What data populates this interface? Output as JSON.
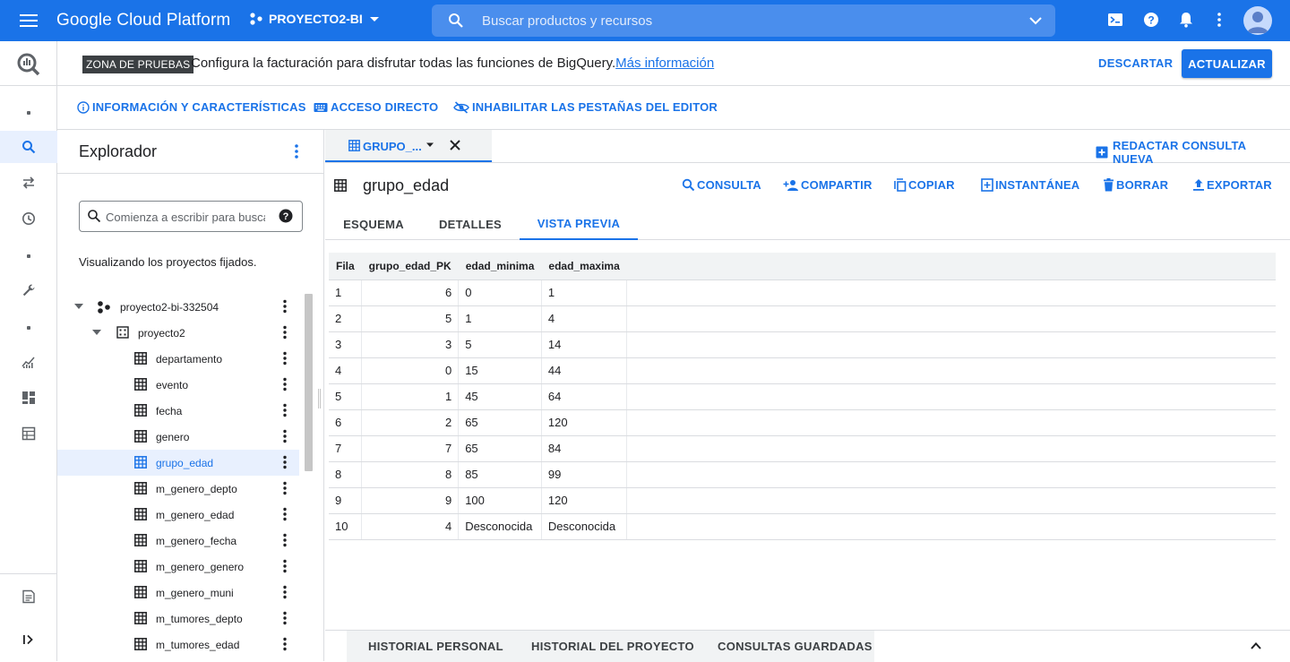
{
  "topbar": {
    "brand": "Google Cloud Platform",
    "project": "PROYECTO2-BI",
    "search_placeholder": "Buscar productos y recursos"
  },
  "banner": {
    "badge": "ZONA DE PRUEBAS",
    "message": "Configura la facturación para disfrutar todas las funciones de BigQuery.",
    "link": "Más información",
    "discard": "DESCARTAR",
    "update": "ACTUALIZAR"
  },
  "info_links": {
    "info": "INFORMACIÓN Y CARACTERÍSTICAS",
    "shortcut": "ACCESO DIRECTO",
    "disable_tabs": "INHABILITAR LAS PESTAÑAS DEL EDITOR"
  },
  "explorer": {
    "title": "Explorador",
    "search_placeholder": "Comienza a escribir para buscar",
    "pinned_note": "Visualizando los proyectos fijados.",
    "project": "proyecto2-bi-332504",
    "dataset": "proyecto2",
    "tables": [
      "departamento",
      "evento",
      "fecha",
      "genero",
      "grupo_edad",
      "m_genero_depto",
      "m_genero_edad",
      "m_genero_fecha",
      "m_genero_genero",
      "m_genero_muni",
      "m_tumores_depto",
      "m_tumores_edad"
    ],
    "selected_table": "grupo_edad"
  },
  "editor": {
    "tab_label": "GRUPO_...",
    "compose": "REDACTAR CONSULTA NUEVA",
    "table_name": "grupo_edad",
    "actions": {
      "query": "CONSULTA",
      "share": "COMPARTIR",
      "copy": "COPIAR",
      "snapshot": "INSTANTÁNEA",
      "delete": "BORRAR",
      "export": "EXPORTAR"
    },
    "subtabs": {
      "schema": "ESQUEMA",
      "details": "DETALLES",
      "preview": "VISTA PREVIA"
    }
  },
  "preview": {
    "columns": [
      "Fila",
      "grupo_edad_PK",
      "edad_minima",
      "edad_maxima"
    ],
    "rows": [
      [
        "1",
        "6",
        "0",
        "1"
      ],
      [
        "2",
        "5",
        "1",
        "4"
      ],
      [
        "3",
        "3",
        "5",
        "14"
      ],
      [
        "4",
        "0",
        "15",
        "44"
      ],
      [
        "5",
        "1",
        "45",
        "64"
      ],
      [
        "6",
        "2",
        "65",
        "120"
      ],
      [
        "7",
        "7",
        "65",
        "84"
      ],
      [
        "8",
        "8",
        "85",
        "99"
      ],
      [
        "9",
        "9",
        "100",
        "120"
      ],
      [
        "10",
        "4",
        "Desconocida",
        "Desconocida"
      ]
    ]
  },
  "bottom_tabs": {
    "personal": "HISTORIAL PERSONAL",
    "project": "HISTORIAL DEL PROYECTO",
    "saved": "CONSULTAS GUARDADAS"
  },
  "colors": {
    "brand_blue": "#1a73e8",
    "selected_bg": "#e8f0fe",
    "header_bg": "#f1f3f4"
  },
  "icons": [
    "menu-icon",
    "project-icon",
    "search-icon",
    "chevron-down-icon",
    "cloud-shell-icon",
    "help-icon",
    "notifications-icon",
    "more-vert-icon",
    "avatar-icon",
    "bigquery-logo-icon",
    "transfers-icon",
    "history-icon",
    "wrench-icon",
    "analytics-icon",
    "dashboard-icon",
    "table-icon",
    "release-notes-icon",
    "expand-rail-icon",
    "info-icon",
    "keyboard-icon",
    "visibility-off-icon",
    "close-icon",
    "add-box-icon",
    "person-add-icon",
    "copy-icon",
    "snapshot-icon",
    "delete-icon",
    "upload-icon",
    "dataset-icon",
    "chevron-up-icon"
  ]
}
